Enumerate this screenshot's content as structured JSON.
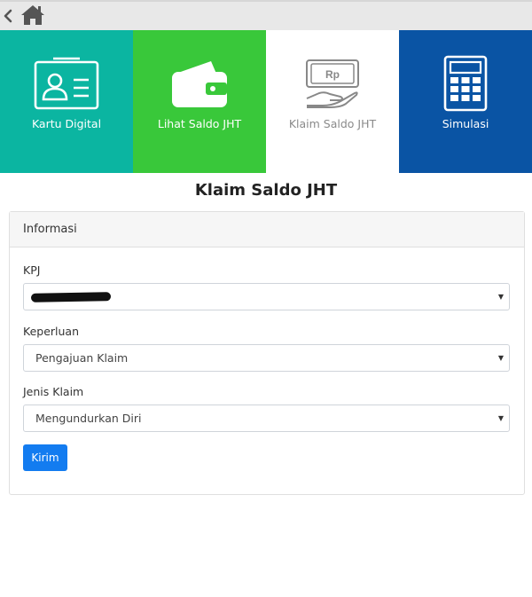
{
  "topbar": {
    "back_icon": "chevron-left-icon",
    "home_icon": "home-icon"
  },
  "tiles": [
    {
      "label": "Kartu Digital",
      "icon": "id-card-icon",
      "color": "#0bb5a1"
    },
    {
      "label": "Lihat Saldo JHT",
      "icon": "wallet-icon",
      "color": "#39c83a"
    },
    {
      "label": "Klaim Saldo JHT",
      "icon": "money-hand-icon",
      "color": "#ffffff",
      "active": true
    },
    {
      "label": "Simulasi",
      "icon": "calculator-icon",
      "color": "#0a54a4"
    }
  ],
  "money_note_text": "Rp",
  "page_title": "Klaim Saldo JHT",
  "card": {
    "header": "Informasi",
    "fields": [
      {
        "label": "KPJ",
        "value": ""
      },
      {
        "label": "Keperluan",
        "value": "Pengajuan Klaim"
      },
      {
        "label": "Jenis Klaim",
        "value": "Mengundurkan Diri"
      }
    ],
    "submit_label": "Kirim"
  },
  "colors": {
    "accent": "#137cf0"
  }
}
